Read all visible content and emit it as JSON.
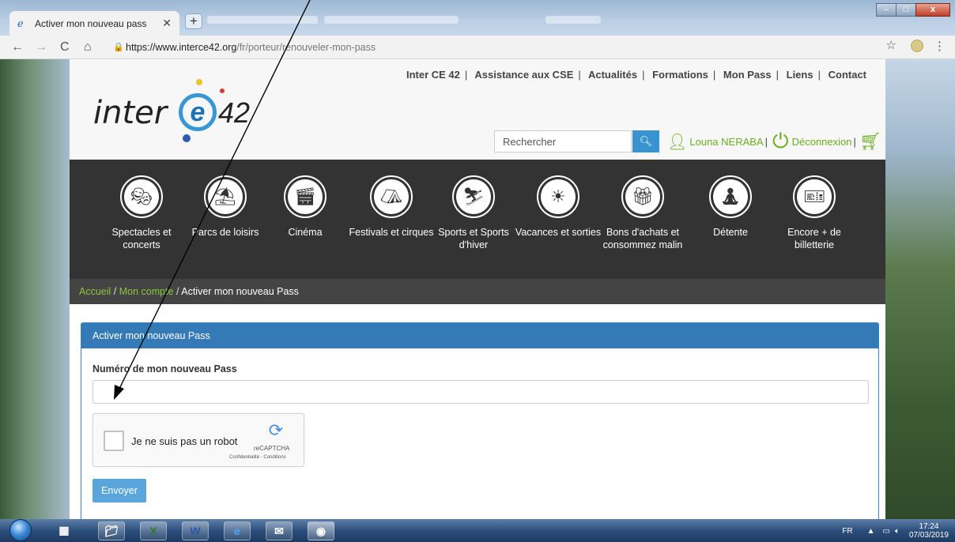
{
  "browser": {
    "tab_title": "Activer mon nouveau pass",
    "url_host": "https://www.interce42.org",
    "url_path": "/fr/porteur/renouveler-mon-pass"
  },
  "site": {
    "logo_text_inter": "inter",
    "logo_text_e": "e",
    "logo_text_42": "42",
    "topnav": [
      "Inter CE 42",
      "Assistance aux CSE",
      "Actualités",
      "Formations",
      "Mon Pass",
      "Liens",
      "Contact"
    ],
    "search_placeholder": "Rechercher",
    "user_name": "Louna NERABA",
    "logout": "Déconnexion",
    "categories": [
      {
        "label": "Spectacles et concerts",
        "icon": "theater-icon"
      },
      {
        "label": "Parcs de loisirs",
        "icon": "parasol-icon"
      },
      {
        "label": "Cinéma",
        "icon": "clapperboard-icon"
      },
      {
        "label": "Festivals et cirques",
        "icon": "circus-tent-icon"
      },
      {
        "label": "Sports et Sports d'hiver",
        "icon": "skier-icon"
      },
      {
        "label": "Vacances et sorties",
        "icon": "beach-chair-icon"
      },
      {
        "label": "Bons d'achats et consommez malin",
        "icon": "gift-icon"
      },
      {
        "label": "Détente",
        "icon": "meditation-icon"
      },
      {
        "label": "Encore + de billetterie",
        "icon": "ticket-icon"
      }
    ],
    "breadcrumb": {
      "home": "Accueil",
      "account": "Mon compte",
      "current": "Activer mon nouveau Pass"
    },
    "panel": {
      "title": "Activer mon nouveau Pass",
      "field_label": "Numéro de mon nouveau Pass",
      "field_value": "",
      "captcha_text": "Je ne suis pas un robot",
      "captcha_brand": "reCAPTCHA",
      "captcha_terms": "Confidentialité - Conditions",
      "submit": "Envoyer"
    }
  },
  "taskbar": {
    "lang": "FR",
    "time": "17:24",
    "date": "07/03/2019"
  },
  "colors": {
    "accent_green": "#6aae1f",
    "panel_blue": "#337ab7",
    "nav_dark": "#333333"
  }
}
